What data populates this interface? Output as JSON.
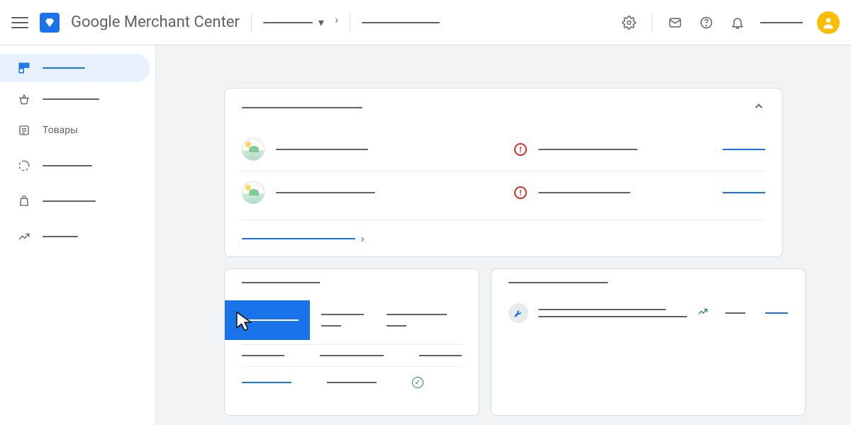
{
  "header": {
    "app_title": "Google Merchant Center"
  },
  "sidebar": {
    "items": [
      {
        "icon": "dashboard",
        "label": ""
      },
      {
        "icon": "basket",
        "label": ""
      },
      {
        "icon": "list",
        "label": "Товары"
      },
      {
        "icon": "circle-dashed",
        "label": ""
      },
      {
        "icon": "bag",
        "label": ""
      },
      {
        "icon": "trend",
        "label": ""
      }
    ]
  },
  "overview_card": {
    "rows": [
      {
        "status": "error"
      },
      {
        "status": "error"
      }
    ]
  },
  "stats_card": {
    "tabs": [
      {
        "active": true
      },
      {
        "active": false
      },
      {
        "active": false
      }
    ],
    "rows": 2
  }
}
